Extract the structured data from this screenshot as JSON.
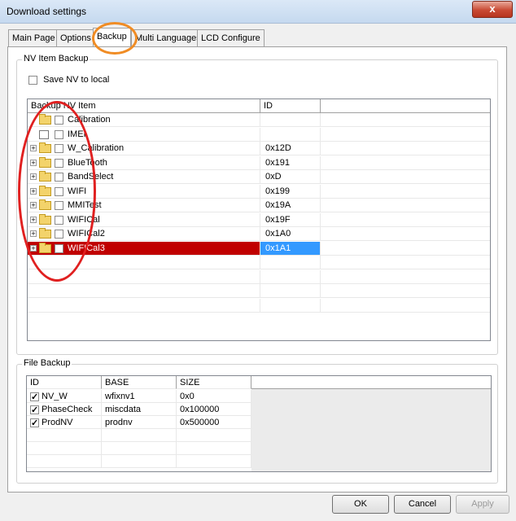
{
  "window": {
    "title": "Download settings",
    "close_glyph": "x"
  },
  "tabs": [
    {
      "label": "Main Page",
      "active": false
    },
    {
      "label": "Options",
      "active": false
    },
    {
      "label": "Backup",
      "active": true
    },
    {
      "label": "Multi Languages",
      "active": false
    },
    {
      "label": "LCD Configure",
      "active": false
    }
  ],
  "nv_group": {
    "label": "NV Item Backup",
    "save_local_label": "Save NV to local",
    "columns": [
      "Backup NV Item",
      "ID"
    ],
    "items": [
      {
        "name": "Calibration",
        "id": "",
        "expandable": false,
        "icon": "folder-icon"
      },
      {
        "name": "IMEI",
        "id": "",
        "expandable": false,
        "icon": "leaf-icon"
      },
      {
        "name": "W_Calibration",
        "id": "0x12D",
        "expandable": true,
        "icon": "folder-icon"
      },
      {
        "name": "BlueTooth",
        "id": "0x191",
        "expandable": true,
        "icon": "folder-icon"
      },
      {
        "name": "BandSelect",
        "id": "0xD",
        "expandable": true,
        "icon": "folder-icon"
      },
      {
        "name": "WIFI",
        "id": "0x199",
        "expandable": true,
        "icon": "folder-icon"
      },
      {
        "name": "MMITest",
        "id": "0x19A",
        "expandable": true,
        "icon": "folder-icon"
      },
      {
        "name": "WIFICal",
        "id": "0x19F",
        "expandable": true,
        "icon": "folder-icon"
      },
      {
        "name": "WIFICal2",
        "id": "0x1A0",
        "expandable": true,
        "icon": "folder-icon"
      },
      {
        "name": "WIFICal3",
        "id": "0x1A1",
        "expandable": true,
        "icon": "folder-icon",
        "selected": true
      }
    ]
  },
  "file_group": {
    "label": "File Backup",
    "columns": [
      "ID",
      "BASE",
      "SIZE"
    ],
    "rows": [
      {
        "id": "NV_W",
        "base": "wfixnv1",
        "size": "0x0",
        "checked": true
      },
      {
        "id": "PhaseCheck",
        "base": "miscdata",
        "size": "0x100000",
        "checked": true
      },
      {
        "id": "ProdNV",
        "base": "prodnv",
        "size": "0x500000",
        "checked": true
      }
    ]
  },
  "buttons": {
    "ok": "OK",
    "cancel": "Cancel",
    "apply": "Apply"
  },
  "colors": {
    "selected_row": "#c00000",
    "selected_id": "#3399ff",
    "annotation_red": "#e02020",
    "annotation_orange": "#f08c24"
  }
}
